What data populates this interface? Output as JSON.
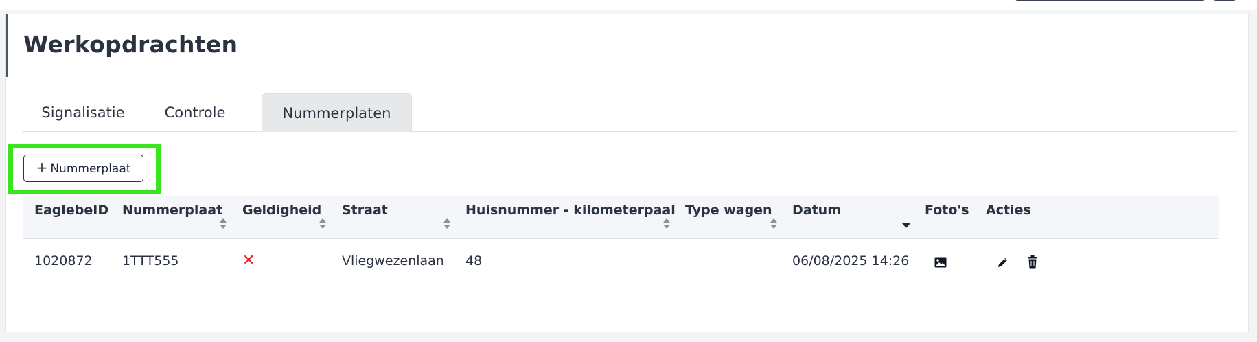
{
  "page": {
    "title": "Werkopdrachten"
  },
  "tabs": [
    {
      "label": "Signalisatie",
      "active": false
    },
    {
      "label": "Controle",
      "active": false
    },
    {
      "label": "Nummerplaten",
      "active": true
    }
  ],
  "actions": {
    "add_button_icon": "+",
    "add_button_label": "Nummerplaat"
  },
  "colors": {
    "highlight": "#39e61e",
    "invalid": "#dc2626",
    "active_tab_bg": "#e7e8ea"
  },
  "table": {
    "columns": [
      {
        "label": "EaglebeID",
        "sortable": false
      },
      {
        "label": "Nummerplaat",
        "sortable": true
      },
      {
        "label": "Geldigheid",
        "sortable": true
      },
      {
        "label": "Straat",
        "sortable": true
      },
      {
        "label": "Huisnummer - kilometerpaal",
        "sortable": true
      },
      {
        "label": "Type wagen",
        "sortable": true
      },
      {
        "label": "Datum",
        "sortable": true,
        "sort_state": "descending"
      },
      {
        "label": "Foto's",
        "sortable": false
      },
      {
        "label": "Acties",
        "sortable": false
      }
    ],
    "rows": [
      {
        "eaglebe_id": "1020872",
        "nummerplaat": "1TTT555",
        "geldigheid": "✕",
        "straat": "Vliegwezenlaan",
        "huisnummer": "48",
        "type_wagen": "",
        "datum": "06/08/2025 14:26",
        "foto_icon": "image-icon",
        "action_icons": [
          "edit-pencil-icon",
          "trash-icon"
        ]
      }
    ]
  }
}
